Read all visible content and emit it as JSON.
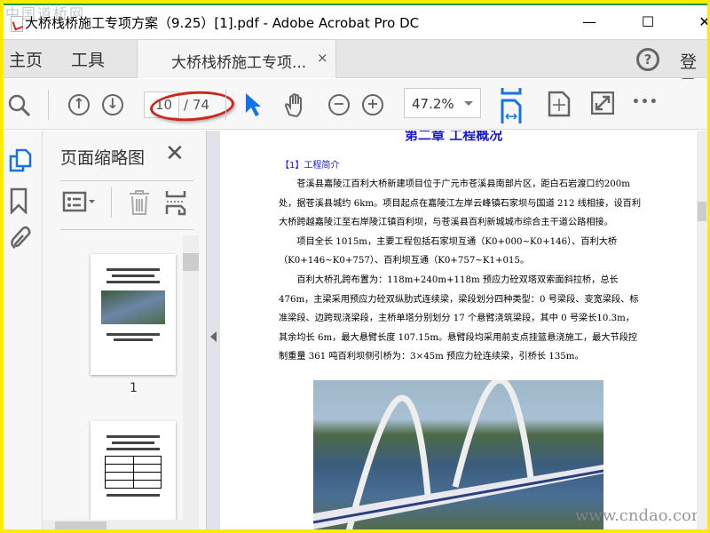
{
  "window": {
    "title": "大桥栈桥施工专项方案（9.25）[1].pdf - Adobe Acrobat Pro DC",
    "watermark_top": "中国道桥网",
    "minimize": "—",
    "maximize": "☐",
    "close": "✕"
  },
  "tabs": {
    "home": "主页",
    "tools": "工具",
    "document": "大桥栈桥施工专项...",
    "doc_close": "×",
    "help": "?",
    "login": "登录"
  },
  "toolbar": {
    "page_current": "10",
    "page_total": "/ 74",
    "zoom": "47.2%",
    "more": "•••"
  },
  "panel": {
    "title": "页面缩略图",
    "close": "✕",
    "thumb_label_1": "1"
  },
  "document": {
    "chapter": "第二章  工程概况",
    "section": "【1】工程简介",
    "paragraphs": [
      "苍溪县嘉陵江百利大桥新建项目位于广元市苍溪县南部片区，距白石岩渡口约200m处，据苍溪县城约 6km。项目起点在嘉陵江左岸云峰镇石家坝与国道 212 线相接，设百利大桥跨越嘉陵江至右岸陵江镇百利坝，与苍溪县百利新城城市综合主干道公路相接。",
      "项目全长 1015m，主要工程包括石家坝互通（K0+000~K0+146）、百利大桥（K0+146~K0+757）、百利坝互通（K0+757~K1+015。",
      "百利大桥孔跨布置为：118m+240m+118m 预应力砼双塔双索面斜拉桥，总长476m，主梁采用预应力砼双纵肋式连续梁，梁段划分四种类型：0 号梁段、变宽梁段、标准梁段、边跨现浇梁段，主桥单塔分别划分 17 个悬臂浇筑梁段，其中 0 号梁长10.3m，其余均长 6m，最大悬臂长度 107.15m。悬臂段均采用前支点挂篮悬浇施工，最大节段控制重量 361 吨百利坝侧引桥为：3×45m 预应力砼连续梁，引桥长 135m。"
    ],
    "watermark": "www.cndao.com"
  },
  "colors": {
    "accent": "#1473e6",
    "annotation": "#c8281e",
    "heading": "#1a1ad0"
  }
}
